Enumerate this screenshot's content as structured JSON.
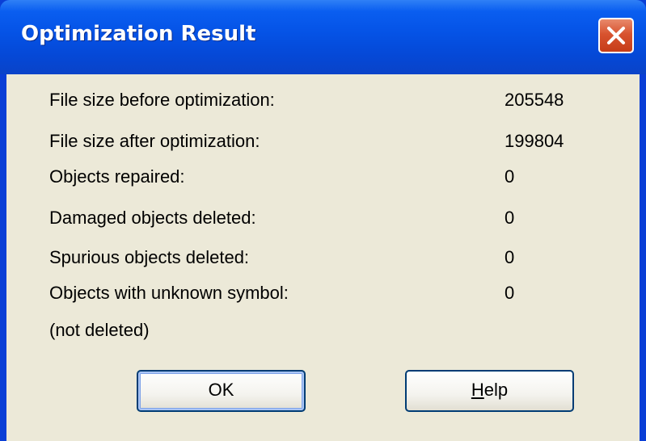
{
  "window": {
    "title": "Optimization Result"
  },
  "results": [
    {
      "label": "File size before optimization:",
      "value": "205548"
    },
    {
      "label": "File size after optimization:",
      "value": "199804"
    },
    {
      "label": "Objects repaired:",
      "value": "0"
    },
    {
      "label": "Damaged objects deleted:",
      "value": "0"
    },
    {
      "label": "Spurious objects deleted:",
      "value": "0"
    },
    {
      "label": "Objects with unknown symbol:",
      "value": "0",
      "note": "(not deleted)"
    }
  ],
  "buttons": {
    "ok_label": "OK",
    "help_mnemonic": "H",
    "help_rest": "elp"
  },
  "icons": {
    "close": "close-icon"
  }
}
